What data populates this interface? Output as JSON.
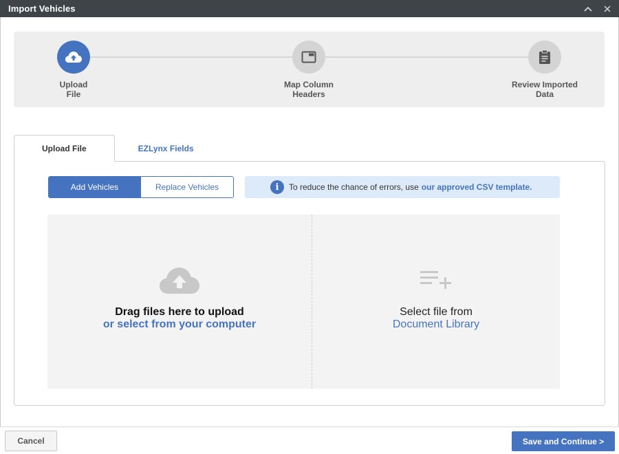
{
  "window": {
    "title": "Import Vehicles",
    "collapse_icon": "chevron-up-icon",
    "close_icon": "close-icon"
  },
  "stepper": {
    "steps": [
      {
        "line1": "Upload",
        "line2": "File",
        "icon": "cloud-upload-icon",
        "active": true
      },
      {
        "line1": "Map Column",
        "line2": "Headers",
        "icon": "window-icon",
        "active": false
      },
      {
        "line1": "Review Imported",
        "line2": "Data",
        "icon": "clipboard-icon",
        "active": false
      }
    ]
  },
  "tabs": [
    {
      "label": "Upload File",
      "active": true
    },
    {
      "label": "EZLynx Fields",
      "active": false
    }
  ],
  "mode_toggle": {
    "options": [
      "Add Vehicles",
      "Replace Vehicles"
    ],
    "selected": "Add Vehicles"
  },
  "notice": {
    "icon": "info-icon",
    "icon_glyph": "i",
    "text": "To reduce the chance of errors, use",
    "link": "our approved CSV template."
  },
  "upload": {
    "left": {
      "icon": "cloud-upload-icon",
      "line1": "Drag files here to upload",
      "line2": "or select from your computer"
    },
    "right": {
      "icon": "playlist-add-icon",
      "line1": "Select file from",
      "line2": "Document Library"
    }
  },
  "footer": {
    "cancel_label": "Cancel",
    "save_label": "Save and Continue >"
  },
  "colors": {
    "accent": "#4673bf",
    "titlebar": "#3f4449",
    "notice_bg": "#ddeaf9"
  }
}
